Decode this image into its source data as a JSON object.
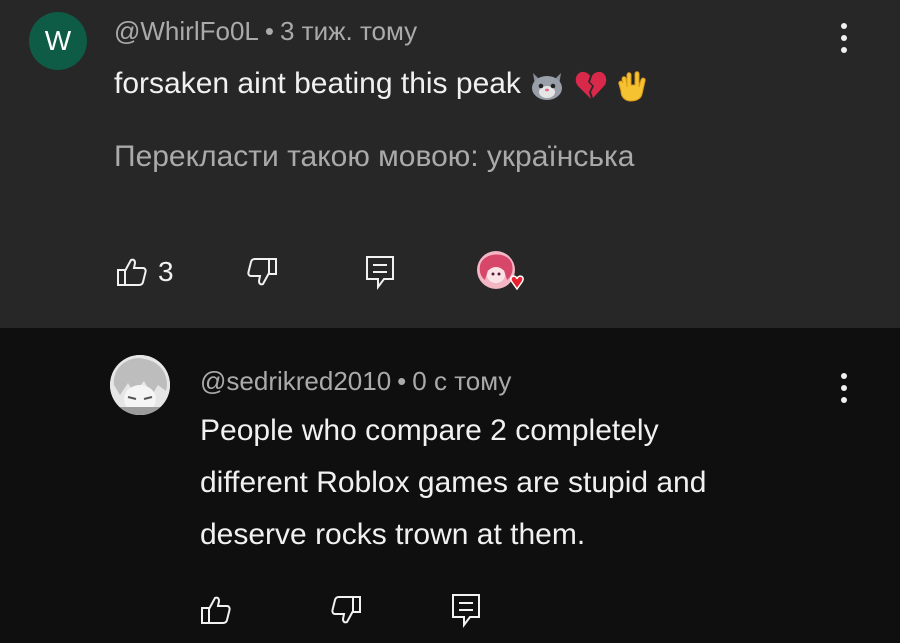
{
  "first_comment": {
    "avatar_letter": "W",
    "author": "@WhirlFo0L",
    "separator": "•",
    "time": "3 тиж. тому",
    "text": "forsaken aint beating this peak",
    "emoji_names": [
      "cat-face-emoji",
      "broken-heart-emoji",
      "vulcan-salute-emoji"
    ],
    "translate_label": "Перекласти такою мовою: українська",
    "like_count": "3"
  },
  "reply": {
    "author": "@sedrikred2010",
    "separator": "•",
    "time": "0 с тому",
    "text_lines": [
      "People who compare 2 completely",
      "different Roblox games are stupid and",
      "deserve rocks trown at them."
    ]
  },
  "colors": {
    "top_background": "#272727",
    "reply_background": "#0f0f0f",
    "avatar_letter_bg": "#0e5c45",
    "meta_text": "#aaaaaa",
    "primary_text": "#f1f1f1",
    "heart": "#e8202f"
  }
}
